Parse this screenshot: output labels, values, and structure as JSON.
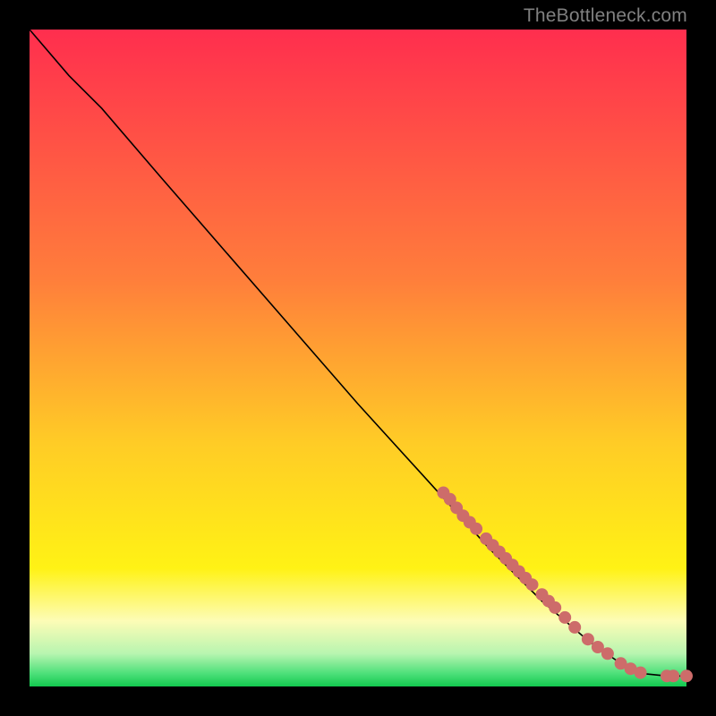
{
  "watermark": "TheBottleneck.com",
  "colors": {
    "gradient": {
      "c0": "#FF2E4E",
      "c1": "#FF7E3B",
      "c2": "#FFCC26",
      "c3": "#FFF215",
      "c4": "#FDFCB6",
      "c5": "#B8F5B0",
      "c6": "#4EE07A",
      "c7": "#13C94F"
    },
    "curve": "#000000",
    "dot": "#CD6C6A"
  },
  "chart_data": {
    "type": "line",
    "title": "",
    "xlabel": "",
    "ylabel": "",
    "xlim": [
      0,
      100
    ],
    "ylim": [
      0,
      100
    ],
    "series": [
      {
        "name": "bottleneck-curve",
        "points": [
          {
            "x": 0,
            "y": 100
          },
          {
            "x": 6,
            "y": 93
          },
          {
            "x": 11,
            "y": 88
          },
          {
            "x": 20,
            "y": 77.5
          },
          {
            "x": 30,
            "y": 66
          },
          {
            "x": 40,
            "y": 54.5
          },
          {
            "x": 50,
            "y": 43
          },
          {
            "x": 60,
            "y": 32
          },
          {
            "x": 70,
            "y": 21
          },
          {
            "x": 78,
            "y": 13
          },
          {
            "x": 85,
            "y": 7
          },
          {
            "x": 90,
            "y": 3.5
          },
          {
            "x": 93,
            "y": 2
          },
          {
            "x": 97,
            "y": 1.6
          },
          {
            "x": 100,
            "y": 1.6
          }
        ]
      },
      {
        "name": "highlight-dots",
        "points": [
          {
            "x": 63,
            "y": 29.5
          },
          {
            "x": 64,
            "y": 28.5
          },
          {
            "x": 65,
            "y": 27.2
          },
          {
            "x": 66,
            "y": 26
          },
          {
            "x": 67,
            "y": 25
          },
          {
            "x": 68,
            "y": 24
          },
          {
            "x": 69.5,
            "y": 22.5
          },
          {
            "x": 70.5,
            "y": 21.5
          },
          {
            "x": 71.5,
            "y": 20.5
          },
          {
            "x": 72.5,
            "y": 19.5
          },
          {
            "x": 73.5,
            "y": 18.5
          },
          {
            "x": 74.5,
            "y": 17.5
          },
          {
            "x": 75.5,
            "y": 16.5
          },
          {
            "x": 76.5,
            "y": 15.5
          },
          {
            "x": 78,
            "y": 14
          },
          {
            "x": 79,
            "y": 13
          },
          {
            "x": 80,
            "y": 12
          },
          {
            "x": 81.5,
            "y": 10.5
          },
          {
            "x": 83,
            "y": 9
          },
          {
            "x": 85,
            "y": 7.2
          },
          {
            "x": 86.5,
            "y": 6
          },
          {
            "x": 88,
            "y": 5
          },
          {
            "x": 90,
            "y": 3.5
          },
          {
            "x": 91.5,
            "y": 2.7
          },
          {
            "x": 93,
            "y": 2.1
          },
          {
            "x": 97,
            "y": 1.6
          },
          {
            "x": 98,
            "y": 1.6
          },
          {
            "x": 100,
            "y": 1.6
          }
        ]
      }
    ]
  }
}
